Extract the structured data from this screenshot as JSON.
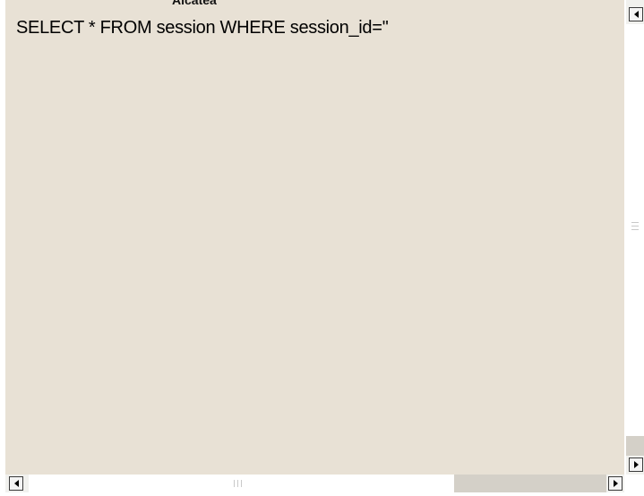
{
  "page": {
    "heading": "Alcatea",
    "query_text": "SELECT * FROM session WHERE session_id=''"
  },
  "colors": {
    "content_background": "#e8e1d5",
    "scroll_track": "#ffffff",
    "scroll_thumb_area": "#d4d0c8"
  },
  "scrollbars": {
    "vertical": {
      "up_icon": "triangle-left-icon",
      "down_icon": "triangle-right-icon"
    },
    "horizontal": {
      "left_icon": "triangle-left-icon",
      "right_icon": "triangle-right-icon"
    }
  }
}
